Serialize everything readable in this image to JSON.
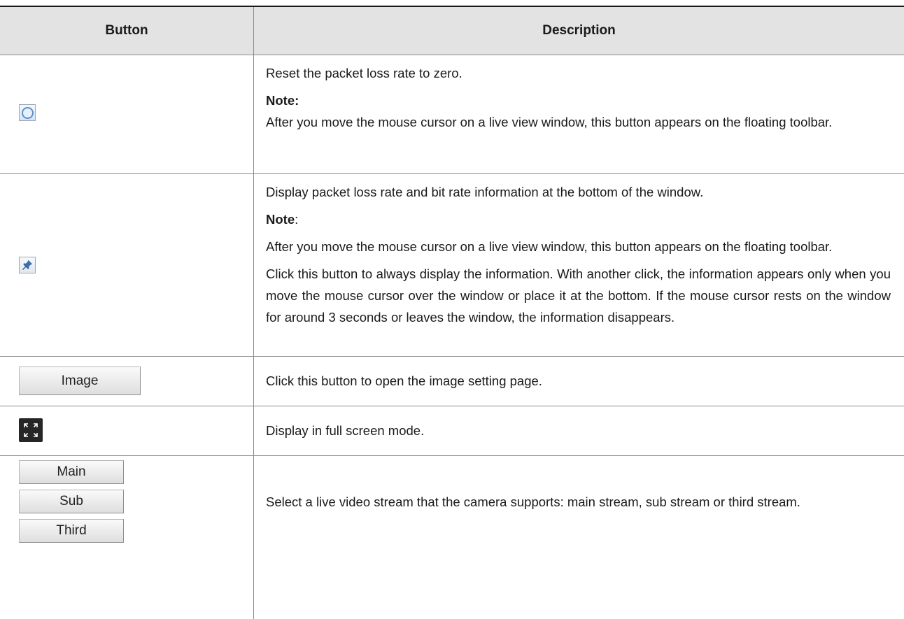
{
  "table": {
    "header": {
      "col1": "Button",
      "col2": "Description"
    },
    "rows": [
      {
        "icon": "reset-circle-icon",
        "lines": [
          "Reset the packet loss rate to zero.",
          "Note:",
          "After you move the mouse cursor on a live view window, this button appears on the floating toolbar."
        ]
      },
      {
        "icon": "pin-icon",
        "lines": [
          "Display packet loss rate and bit rate information at the bottom of the window.",
          "Note",
          ":",
          "After you move the mouse cursor on a live view window, this button appears on the floating toolbar.",
          "Click this button to always display the information. With another click, the information appears only when you move the mouse cursor over the window or place it at the bottom. If the mouse cursor rests on the window for around 3 seconds or leaves the window, the information disappears."
        ]
      },
      {
        "button_label": "Image",
        "lines": [
          "Click this button to open the image setting page."
        ]
      },
      {
        "icon": "fullscreen-icon",
        "lines": [
          "Display in full screen mode."
        ]
      },
      {
        "stream_buttons": [
          "Main",
          "Sub",
          "Third"
        ],
        "lines": [
          "Select a live video stream that the camera supports: main stream, sub stream or third stream."
        ]
      }
    ]
  }
}
